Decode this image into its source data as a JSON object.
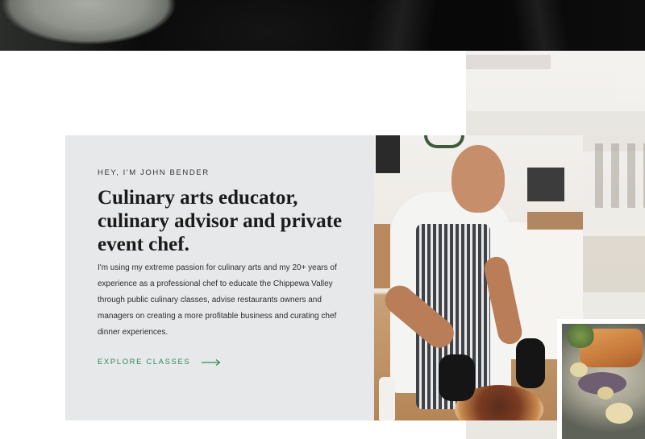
{
  "intro": {
    "eyebrow": "HEY, I'M JOHN BENDER",
    "headline": "Culinary arts educator, culinary advisor and private event chef.",
    "body": "I'm using my extreme passion for culinary arts and my 20+ years of experience as a professional chef to educate the Chippewa Valley through public culinary classes, advise restaurants owners and managers on creating a more profitable business and curating chef dinner experiences.",
    "cta_label": "EXPLORE CLASSES",
    "cta_icon": "arrow-right-icon"
  },
  "colors": {
    "card_background": "#e7e8e9",
    "cta_accent": "#2e8a5a",
    "headline_text": "#1a1a1a"
  },
  "images": {
    "top": "dark-plate-photo",
    "chef": "chef-slicing-pizza-photo",
    "food": "plated-fish-dish-photo",
    "background": "faded-kitchen-photo"
  }
}
